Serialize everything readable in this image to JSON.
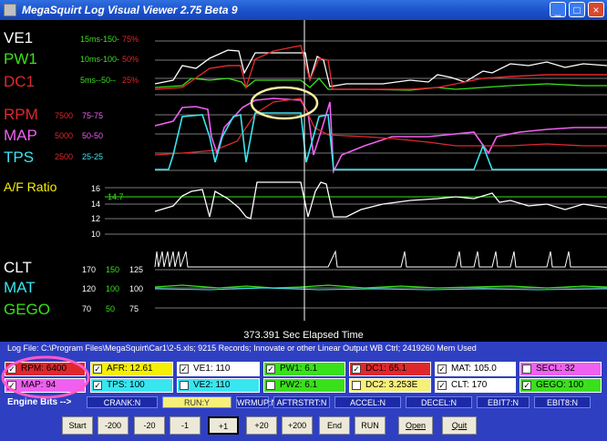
{
  "window": {
    "title": "MegaSquirt Log Visual Viewer 2.75 Beta 9"
  },
  "channels": {
    "ve1": {
      "label": "VE1",
      "scale": "15ms-150-",
      "scale2": "75%"
    },
    "pw1": {
      "label": "PW1",
      "scale": "10ms-100-",
      "scale2": "50%"
    },
    "dc1": {
      "label": "DC1",
      "scale": "5ms--50--",
      "scale2": "25%"
    },
    "rpm": {
      "label": "RPM",
      "scale": "7500",
      "scale2": "75-75"
    },
    "map": {
      "label": "MAP",
      "scale": "5000",
      "scale2": "50-50"
    },
    "tps": {
      "label": "TPS",
      "scale": "2500",
      "scale2": "25-25"
    },
    "afr": {
      "label": "A/F Ratio",
      "ticks": [
        "16",
        "14.7",
        "14",
        "12",
        "10"
      ]
    },
    "clt": {
      "label": "CLT",
      "scale": "170",
      "scale2": "150",
      "scale3": "125"
    },
    "mat": {
      "label": "MAT",
      "scale": "120",
      "scale2": "100",
      "scale3": "100"
    },
    "gego": {
      "label": "GEGO",
      "scale": "70",
      "scale2": "50",
      "scale3": "75"
    }
  },
  "elapsed": "373.391 Sec Elapsed Time",
  "logfile": "Log File: C:\\Program Files\\MegaSquirt\\Car1\\2-5.xls; 9215 Records; Innovate or other Linear Output WB Ctrl; 2419260 Mem Used",
  "readouts": {
    "rpm": "RPM: 6400",
    "afr": "AFR: 12.61",
    "ve1": "VE1: 110",
    "pw1": "PW1: 6.1",
    "dc1": "DC1: 65.1",
    "mat": "MAT: 105.0",
    "secl": "SECL: 32",
    "map": "MAP: 94",
    "tps": "TPS: 100",
    "ve2": "VE2: 110",
    "pw2": "PW2: 6.1",
    "dc2": "DC2: 3.253E",
    "clt": "CLT: 170",
    "gego": "GEGO: 100"
  },
  "colors": {
    "rpm": "#e0282c",
    "afr": "#f6f000",
    "pw": "#39e11b",
    "dc": "#e0282c",
    "mat": "#ffffff",
    "secl": "#f060f0",
    "map": "#f060f0",
    "tps": "#38e6f0",
    "clt": "#ffffff",
    "gego": "#39e11b"
  },
  "engine_bits": {
    "label": "Engine Bits -->",
    "items": [
      "CRANK:N",
      "RUN:Y",
      "WRMUP:N",
      "AFTRSTRT:N",
      "ACCEL:N",
      "DECEL:N",
      "EBIT7:N",
      "EBIT8:N"
    ]
  },
  "nav": {
    "start": "Start",
    "m200": "-200",
    "m20": "-20",
    "m1": "-1",
    "p1": "+1",
    "p20": "+20",
    "p200": "+200",
    "end": "End",
    "run": "RUN",
    "open": "Open",
    "quit": "Quit"
  }
}
